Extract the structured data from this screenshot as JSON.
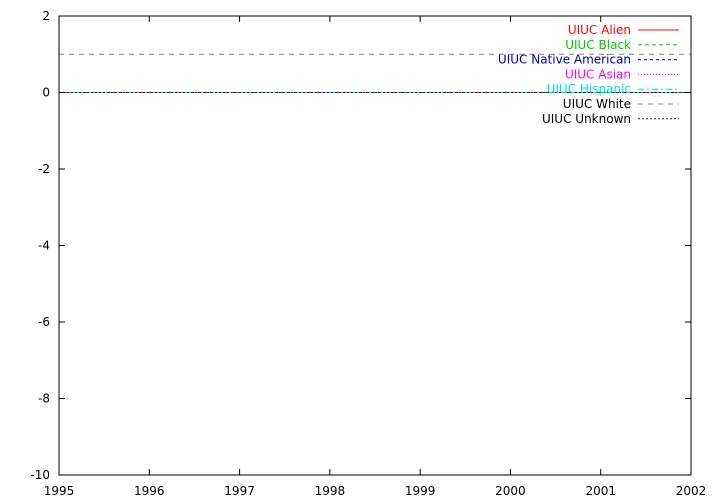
{
  "chart_data": {
    "type": "line",
    "title": "",
    "xlabel": "",
    "ylabel": "",
    "xlim": [
      1995,
      2002
    ],
    "ylim": [
      -10,
      2
    ],
    "xticks": [
      "1995",
      "1996",
      "1997",
      "1998",
      "1999",
      "2000",
      "2001",
      "2002"
    ],
    "yticks": [
      "2",
      "0",
      "-2",
      "-4",
      "-6",
      "-8",
      "-10"
    ],
    "grid": false,
    "legend_position": "top-right",
    "series": [
      {
        "name": "UIUC Alien",
        "color": "#ff0000",
        "dash": "solid",
        "x": [
          1995,
          2002
        ],
        "y": [
          0,
          0
        ]
      },
      {
        "name": "UIUC Black",
        "color": "#00cc00",
        "dash": "dashed",
        "x": [
          1995,
          2002
        ],
        "y": [
          0,
          0
        ]
      },
      {
        "name": "UIUC Native American",
        "color": "#0000a0",
        "dash": "dashed-fine",
        "x": [
          1995,
          2002
        ],
        "y": [
          0,
          0
        ]
      },
      {
        "name": "UIUC Asian",
        "color": "#ff00ff",
        "dash": "dotted",
        "x": [
          1995,
          2002
        ],
        "y": [
          0,
          0
        ]
      },
      {
        "name": "UIUC Hispanic",
        "color": "#00dddd",
        "dash": "dash-dot",
        "x": [
          1995,
          2002
        ],
        "y": [
          0,
          0
        ]
      },
      {
        "name": "UIUC White",
        "color": "#808080",
        "dash": "long-dash",
        "x": [
          1995,
          2002
        ],
        "y": [
          1,
          1
        ]
      },
      {
        "name": "UIUC Unknown",
        "color": "#202040",
        "dash": "dense-dot",
        "x": [
          1995,
          2002
        ],
        "y": [
          0,
          0
        ]
      }
    ]
  }
}
